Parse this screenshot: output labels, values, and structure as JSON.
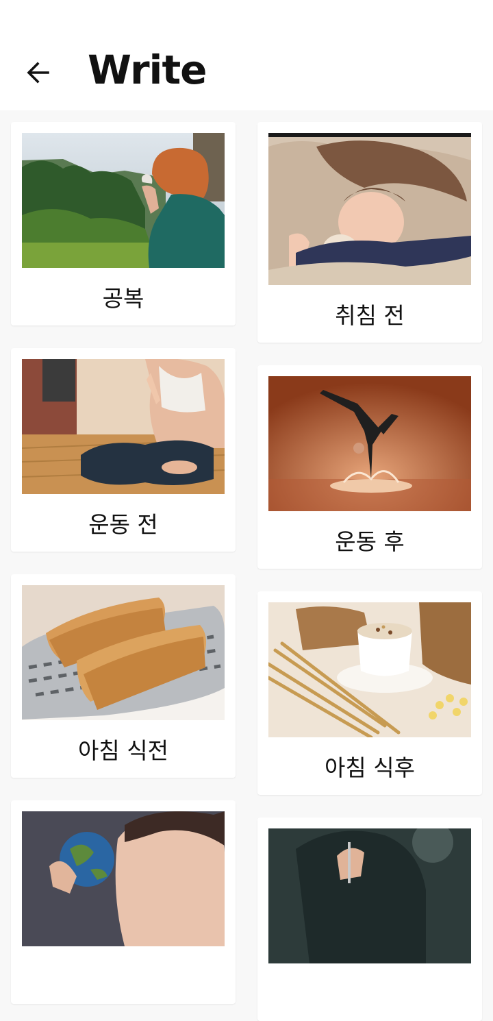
{
  "header": {
    "title": "Write",
    "back_icon": "arrow-left-icon"
  },
  "cards": [
    {
      "label": "공복",
      "image": "woman drinking from cup beside forest mountain view"
    },
    {
      "label": "취침 전",
      "image": "girl sleeping with stuffed toy"
    },
    {
      "label": "운동 전",
      "image": "woman in yoga lotus pose with hands together"
    },
    {
      "label": "운동 후",
      "image": "dancer doing handstand on a splash of liquid"
    },
    {
      "label": "아침 식전",
      "image": "two toast slices in a toaster"
    },
    {
      "label": "아침 식후",
      "image": "cup of cereal with wheat stalks and burlap sacks"
    },
    {
      "label": "",
      "image": "woman holding globe near her mouth"
    },
    {
      "label": "",
      "image": "person holding a fork at a table"
    }
  ]
}
